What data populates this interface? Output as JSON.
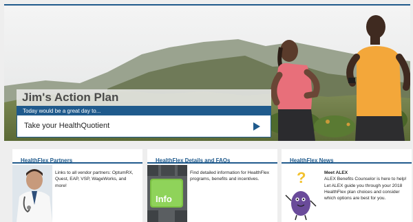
{
  "hero": {
    "plan_title": "Jim's Action Plan",
    "prompt": "Today would be a great day to...",
    "action_label": "Take your HealthQuotient"
  },
  "cards": [
    {
      "title": "HealthFlex Partners",
      "text": "Links to all vendor partners: OptumRX, Quest, EAP, VSP, WageWorks, and more!"
    },
    {
      "title": "HealthFlex Details and FAQs",
      "image_label": "Info",
      "text": "Find detailed information for HealthFlex programs, benefits and incentives."
    },
    {
      "title": "HealthFlex News",
      "lead": "Meet ALEX",
      "text": "ALEX Benefits Counselor is here to help! Let ALEX guide you through your 2018 HealthFlex plan choices and consider which options are best for you."
    }
  ],
  "colors": {
    "brand_blue": "#1f5a8c",
    "card_bg": "#ffffff",
    "page_bg": "#eeeeee"
  },
  "icons": {
    "action_arrow": "play-triangle-icon",
    "partners_image": "doctor-icon",
    "details_image": "info-key-icon",
    "news_image": "alex-character-icon"
  }
}
